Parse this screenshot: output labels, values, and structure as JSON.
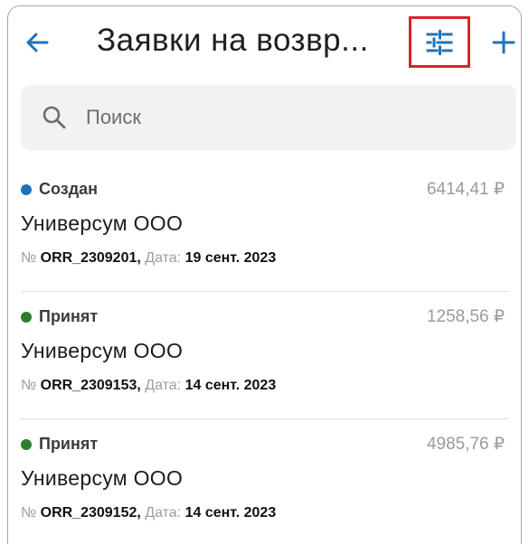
{
  "header": {
    "back_icon": "arrow-left-icon",
    "title": "Заявки на возвр...",
    "filter_icon": "sliders-icon",
    "add_icon": "plus-icon"
  },
  "colors": {
    "accent": "#1e73b8",
    "highlight": "#d9232d",
    "status_created": "#1e73b8",
    "status_accepted": "#2f7d32"
  },
  "search": {
    "icon": "search-icon",
    "placeholder": "Поиск"
  },
  "requests": [
    {
      "status": "Создан",
      "status_color": "#1e73b8",
      "amount": "6414,41 ₽",
      "client": "Универсум ООО",
      "number_label": "№",
      "number": "ORR_2309201,",
      "date_label": "Дата:",
      "date": "19 сент. 2023"
    },
    {
      "status": "Принят",
      "status_color": "#2f7d32",
      "amount": "1258,56 ₽",
      "client": "Универсум ООО",
      "number_label": "№",
      "number": "ORR_2309153,",
      "date_label": "Дата:",
      "date": "14 сент. 2023"
    },
    {
      "status": "Принят",
      "status_color": "#2f7d32",
      "amount": "4985,76 ₽",
      "client": "Универсум ООО",
      "number_label": "№",
      "number": "ORR_2309152,",
      "date_label": "Дата:",
      "date": "14 сент. 2023"
    }
  ]
}
